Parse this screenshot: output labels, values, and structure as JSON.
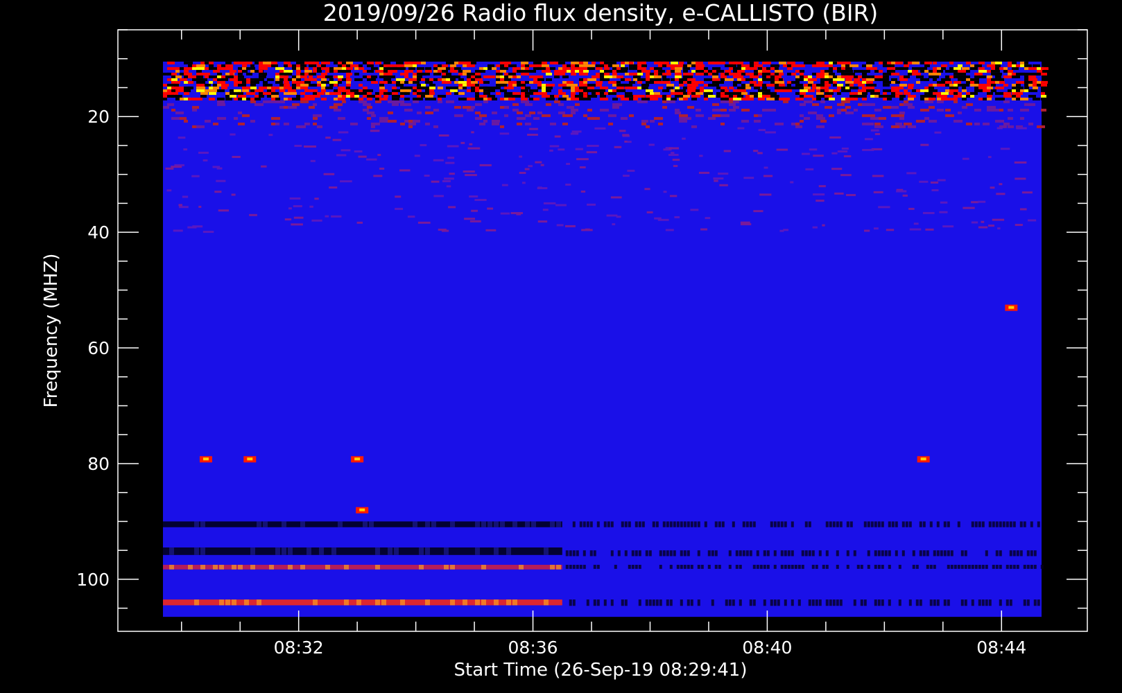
{
  "chart_data": {
    "type": "heatmap",
    "title": "2019/09/26  Radio flux density, e-CALLISTO (BIR)",
    "xlabel": "Start Time (26-Sep-19 08:29:41)",
    "ylabel": "Frequency (MHZ)",
    "x_range": [
      "08:29:41",
      "08:44:41"
    ],
    "y_range": [
      10.5,
      106.5
    ],
    "ylim": [
      5,
      109
    ],
    "y_inverted": true,
    "x_ticks": [
      "08:32",
      "08:36",
      "08:40",
      "08:44"
    ],
    "y_ticks": [
      20,
      40,
      60,
      80,
      100
    ],
    "colormap": [
      "#000000",
      "#0000ff",
      "#ff0000",
      "#ffff00",
      "#ffffff"
    ],
    "background_color": "#1a10e8",
    "hot_spots": [
      {
        "time": "08:30:25",
        "freq": 79.2
      },
      {
        "time": "08:31:10",
        "freq": 79.2
      },
      {
        "time": "08:33:00",
        "freq": 79.2
      },
      {
        "time": "08:33:05",
        "freq": 88.0
      },
      {
        "time": "08:42:40",
        "freq": 79.2
      },
      {
        "time": "08:44:10",
        "freq": 53.0
      }
    ],
    "bands": [
      {
        "freq_range": [
          10.5,
          17
        ],
        "level": "high"
      },
      {
        "freq_range": [
          103.5,
          104.5
        ],
        "time_range": [
          "08:29:41",
          "08:36:30"
        ],
        "level": "high"
      },
      {
        "freq_range": [
          97.5,
          98.3
        ],
        "time_range": [
          "08:29:41",
          "08:36:30"
        ],
        "level": "medium"
      },
      {
        "freq_range": [
          94.5,
          95.8
        ],
        "time_range": [
          "08:29:41",
          "08:36:30"
        ],
        "level": "low"
      },
      {
        "freq_range": [
          90,
          91
        ],
        "time_range": [
          "08:29:41",
          "08:36:30"
        ],
        "level": "low"
      }
    ]
  }
}
